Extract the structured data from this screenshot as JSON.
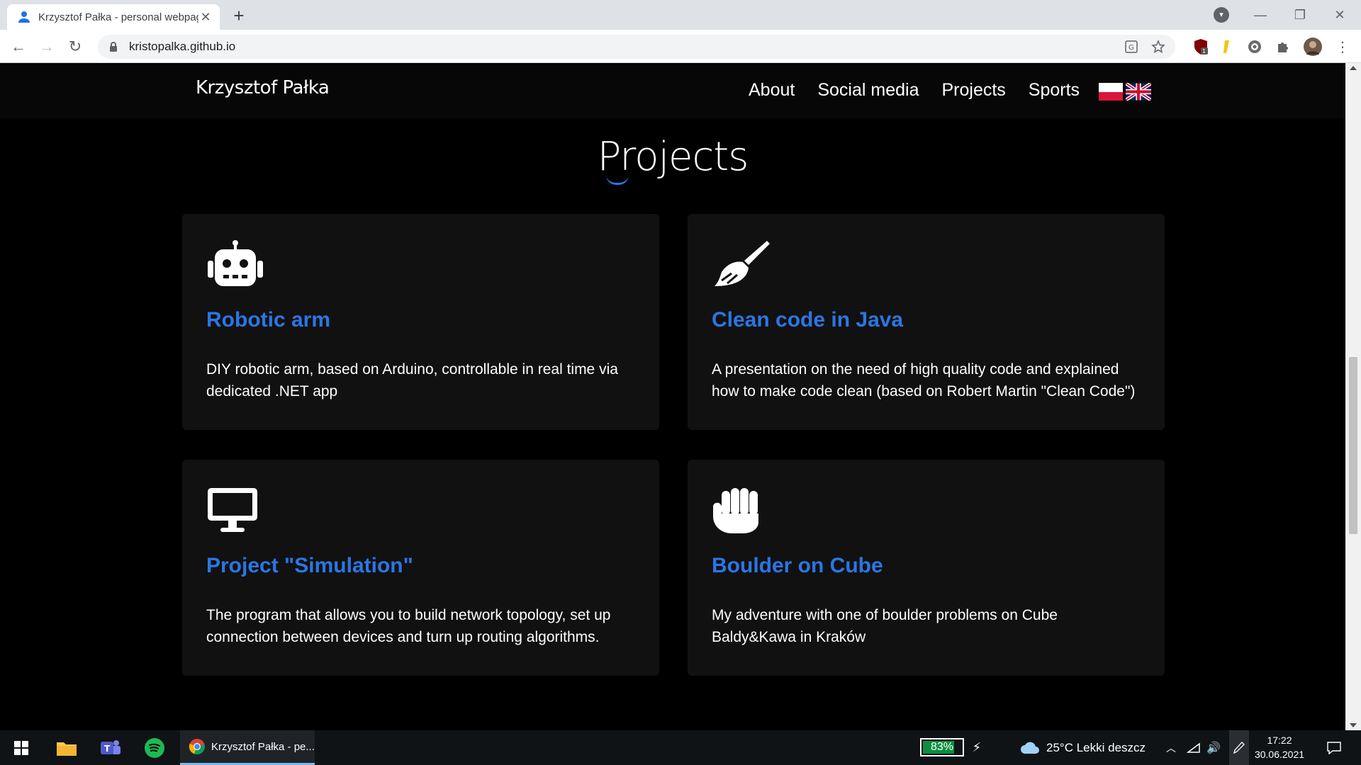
{
  "browser": {
    "tab_title": "Krzysztof Pałka - personal webpage",
    "url": "kristopalka.github.io",
    "new_tab_label": "+"
  },
  "navbar": {
    "brand": "Krzysztof Pałka",
    "links": [
      "About",
      "Social media",
      "Projects",
      "Sports"
    ]
  },
  "section": {
    "title": "Projects"
  },
  "projects": [
    {
      "icon": "robot-icon",
      "title": "Robotic arm",
      "description": "DIY robotic arm, based on Arduino, controllable in real time via dedicated .NET app"
    },
    {
      "icon": "broom-icon",
      "title": "Clean code in Java",
      "description": "A presentation on the need of high quality code and explained how to make code clean (based on Robert Martin \"Clean Code\")"
    },
    {
      "icon": "monitor-icon",
      "title": "Project \"Simulation\"",
      "description": "The program that allows you to build network topology, set up connection between devices and turn up routing algorithms."
    },
    {
      "icon": "fist-icon",
      "title": "Boulder on Cube",
      "description": "My adventure with one of boulder problems on Cube Baldy&Kawa in Kraków"
    }
  ],
  "taskbar": {
    "chrome_window_label": "Krzysztof Pałka - pe...",
    "battery_label": "83%",
    "battery_level": 0.83,
    "weather": "25°C  Lekki deszcz",
    "time": "17:22",
    "date": "30.06.2021"
  },
  "colors": {
    "accent": "#2b76e5",
    "card_bg": "#111111",
    "page_bg": "#000000"
  }
}
